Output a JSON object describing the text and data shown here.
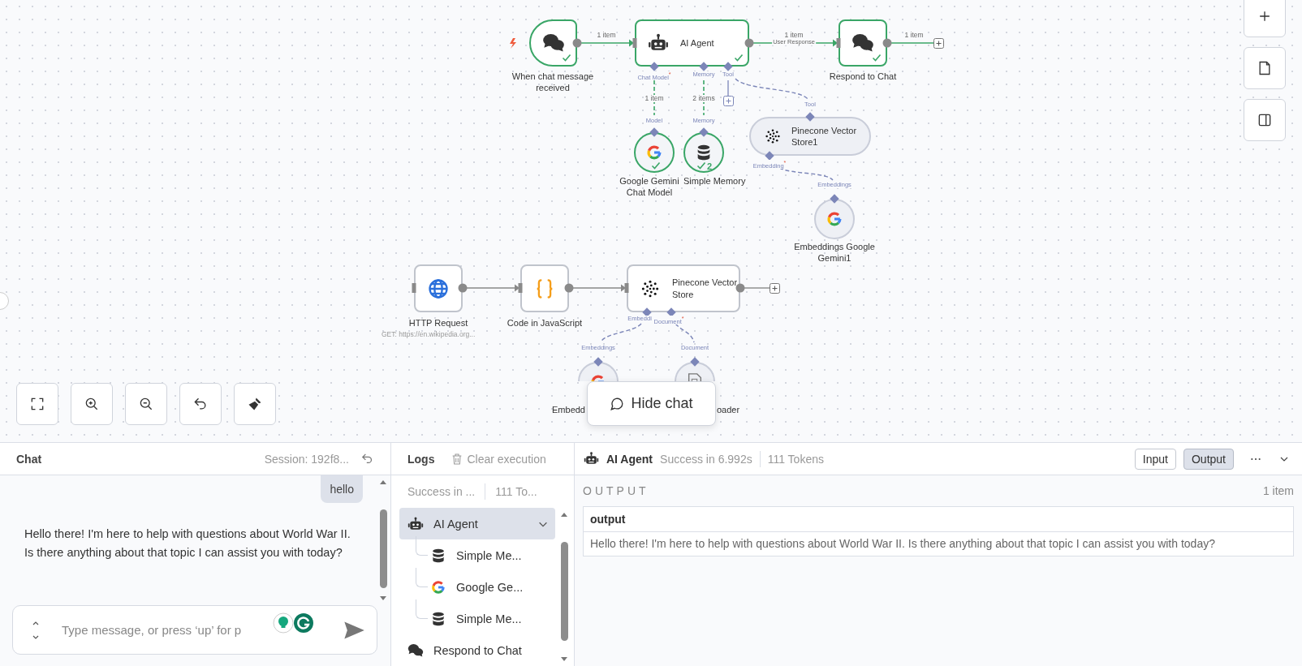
{
  "canvas": {
    "nodes": [
      {
        "kind": "chat_trigger",
        "label": "When chat message received",
        "executed": true
      },
      {
        "kind": "agent",
        "label": "AI Agent",
        "executed": true
      },
      {
        "kind": "chat_respond",
        "label": "Respond to Chat",
        "executed": true
      },
      {
        "kind": "chat_model",
        "label": "Google Gemini Chat Model",
        "executed": true
      },
      {
        "kind": "memory",
        "label": "Simple Memory",
        "executed": true,
        "count": "2"
      },
      {
        "kind": "vector_tool",
        "label": "Pinecone Vector Store1",
        "executed": false
      },
      {
        "kind": "embeddings",
        "label": "Embeddings Google Gemini1",
        "executed": false
      },
      {
        "kind": "http",
        "label": "HTTP Request",
        "subtitle": "GET: https://en.wikipedia.org...",
        "executed": false
      },
      {
        "kind": "code",
        "label": "Code in JavaScript",
        "executed": false
      },
      {
        "kind": "vector_store",
        "label": "Pinecone Vector Store",
        "executed": false
      },
      {
        "kind": "embeddings",
        "label": "Embedd",
        "executed": false
      },
      {
        "kind": "document_loader",
        "label": "oader",
        "executed": false
      }
    ],
    "edges": [
      {
        "label": "1 item"
      },
      {
        "label": "1 item",
        "note": "User Response"
      },
      {
        "label": "1 item"
      },
      {
        "label": "1 item"
      },
      {
        "label": "2 items"
      }
    ],
    "ports": [
      "Chat Model$^{*}$",
      "Memory",
      "Tool",
      "Model",
      "Memory",
      "Tool",
      "Embedding$^{*}$",
      "Embeddings",
      "Embeddi",
      "Document$^{*}$",
      "Embeddings",
      "Document"
    ],
    "hide_chat": "Hide chat"
  },
  "chat": {
    "title": "Chat",
    "session": "Session: 192f8...",
    "messages": [
      {
        "kind": "user",
        "text": "hello"
      },
      {
        "kind": "bot",
        "text": "Hello there! I'm here to help with questions about World War II. Is there anything about that topic I can assist you with today?"
      }
    ],
    "input": {
      "placeholder": "Type message, or press ‘up’ for p"
    }
  },
  "logs": {
    "title": "Logs",
    "clear": "Clear execution",
    "status": "Success in ...",
    "tokens": "111 To...",
    "items": [
      {
        "kind": "agent",
        "label": "AI Agent",
        "selected": true,
        "expanded": true,
        "children": [
          {
            "kind": "memory",
            "label": "Simple Me...",
            "selected": false
          },
          {
            "kind": "chat_model",
            "label": "Google Ge...",
            "selected": false
          },
          {
            "kind": "memory",
            "label": "Simple Me...",
            "selected": false
          }
        ]
      },
      {
        "kind": "chat_respond",
        "label": "Respond to Chat",
        "selected": false
      }
    ]
  },
  "run": {
    "node": "AI Agent",
    "status": "Success in 6.992s",
    "tokens": "111 Tokens",
    "tabs": [
      {
        "label": "Input",
        "selected": false
      },
      {
        "label": "Output",
        "selected": true
      }
    ],
    "section": "OUTPUT",
    "count": "1 item",
    "table": {
      "columns": [
        "output"
      ],
      "rows": [
        [
          "Hello there! I'm here to help with questions about World War II. Is there anything about that topic I can assist you with today?"
        ]
      ]
    }
  }
}
